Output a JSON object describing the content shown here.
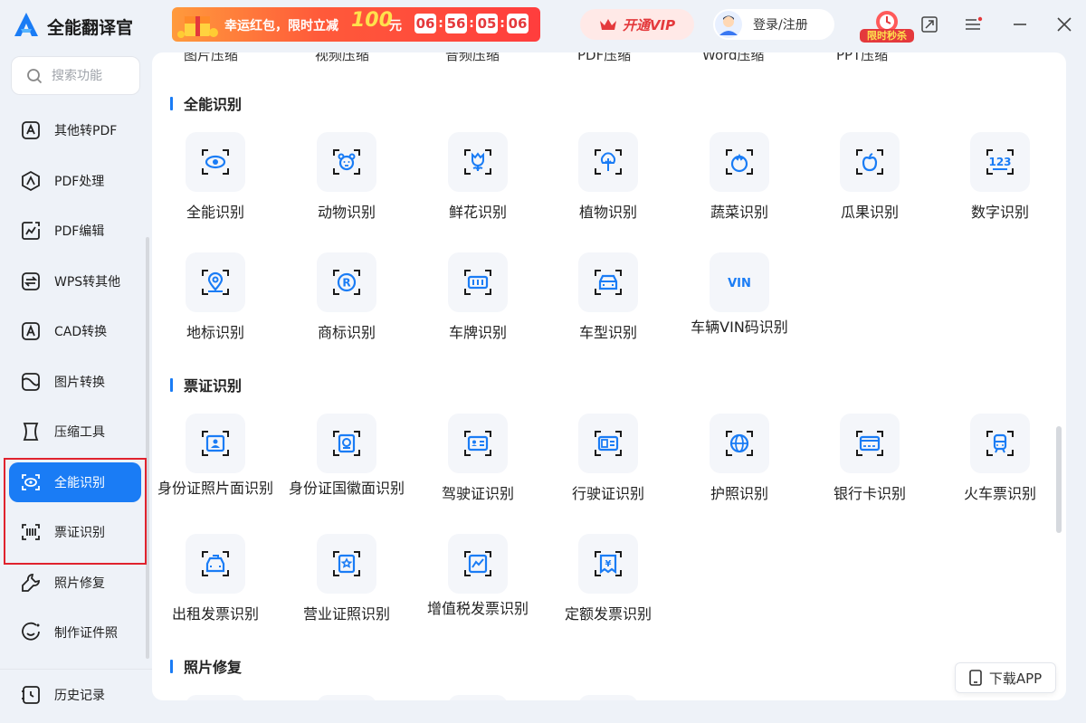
{
  "app": {
    "title": "全能翻译官"
  },
  "promo": {
    "text": "幸运红包，限时立减",
    "amount": "100",
    "unit": "元",
    "timer": [
      "06",
      "56",
      "05",
      "06"
    ]
  },
  "header": {
    "vip_label": "开通VIP",
    "login_label": "登录/注册",
    "flash_sale": "限时秒杀"
  },
  "sidebar": {
    "search_placeholder": "搜索功能",
    "items": [
      {
        "label": "其他转PDF",
        "icon": "pdf-convert-icon"
      },
      {
        "label": "PDF处理",
        "icon": "pdf-process-icon"
      },
      {
        "label": "PDF编辑",
        "icon": "pdf-edit-icon"
      },
      {
        "label": "WPS转其他",
        "icon": "wps-convert-icon"
      },
      {
        "label": "CAD转换",
        "icon": "cad-icon"
      },
      {
        "label": "图片转换",
        "icon": "image-convert-icon"
      },
      {
        "label": "压缩工具",
        "icon": "compress-icon"
      },
      {
        "label": "全能识别",
        "icon": "eye-scan-icon",
        "active": true
      },
      {
        "label": "票证识别",
        "icon": "barcode-scan-icon"
      },
      {
        "label": "照片修复",
        "icon": "wrench-icon"
      },
      {
        "label": "制作证件照",
        "icon": "smile-face-icon"
      }
    ],
    "history_label": "历史记录"
  },
  "main": {
    "cut_row": [
      "图片压缩",
      "视频压缩",
      "音频压缩",
      "PDF压缩",
      "Word压缩",
      "PPT压缩"
    ],
    "sections": [
      {
        "title": "全能识别",
        "tools": [
          {
            "label": "全能识别",
            "icon": "eye-icon"
          },
          {
            "label": "动物识别",
            "icon": "animal-icon"
          },
          {
            "label": "鲜花识别",
            "icon": "flower-icon"
          },
          {
            "label": "植物识别",
            "icon": "plant-icon"
          },
          {
            "label": "蔬菜识别",
            "icon": "vegetable-icon"
          },
          {
            "label": "瓜果识别",
            "icon": "fruit-icon"
          },
          {
            "label": "数字识别",
            "icon": "digits-icon",
            "glyph": "123"
          },
          {
            "label": "地标识别",
            "icon": "location-icon"
          },
          {
            "label": "商标识别",
            "icon": "trademark-icon",
            "glyph": "R"
          },
          {
            "label": "车牌识别",
            "icon": "license-plate-icon"
          },
          {
            "label": "车型识别",
            "icon": "car-icon"
          },
          {
            "label": "车辆VIN码识别",
            "icon": "vin-icon",
            "glyph": "VIN"
          }
        ]
      },
      {
        "title": "票证识别",
        "tools": [
          {
            "label": "身份证照片面识别",
            "icon": "id-card-photo-icon"
          },
          {
            "label": "身份证国徽面识别",
            "icon": "id-card-emblem-icon"
          },
          {
            "label": "驾驶证识别",
            "icon": "driver-license-icon"
          },
          {
            "label": "行驶证识别",
            "icon": "vehicle-license-icon"
          },
          {
            "label": "护照识别",
            "icon": "passport-icon"
          },
          {
            "label": "银行卡识别",
            "icon": "bank-card-icon"
          },
          {
            "label": "火车票识别",
            "icon": "train-ticket-icon"
          },
          {
            "label": "出租发票识别",
            "icon": "taxi-invoice-icon"
          },
          {
            "label": "营业证照识别",
            "icon": "business-license-icon"
          },
          {
            "label": "增值税发票识别",
            "icon": "vat-invoice-icon"
          },
          {
            "label": "定额发票识别",
            "icon": "quota-invoice-icon",
            "glyph": "¥"
          }
        ]
      },
      {
        "title": "照片修复",
        "tools": []
      }
    ]
  },
  "download_app_label": "下载APP",
  "colors": {
    "accent": "#1a7cf5",
    "promo_red": "#e4393c",
    "highlight": "#e0232e"
  }
}
